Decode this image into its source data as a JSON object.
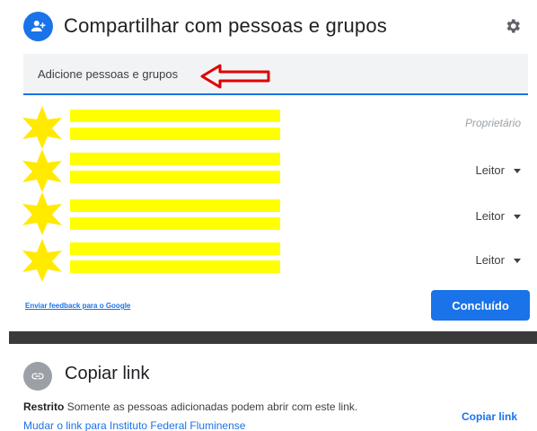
{
  "dialog": {
    "title": "Compartilhar com pessoas e grupos",
    "add_people_placeholder": "Adicione pessoas e grupos"
  },
  "people": [
    {
      "role": "Proprietário",
      "redacted": true
    },
    {
      "role": "Leitor",
      "redacted": true
    },
    {
      "role": "Leitor",
      "redacted": true
    },
    {
      "role": "Leitor",
      "redacted": true
    }
  ],
  "footer": {
    "feedback_link": "Enviar feedback para o Google",
    "done_button": "Concluído"
  },
  "link_section": {
    "title": "Copiar link",
    "restriction_label": "Restrito",
    "restriction_text": "Somente as pessoas adicionadas podem abrir com este link.",
    "change_link": "Mudar o link para Instituto Federal Fluminense",
    "copy_button": "Copiar link"
  },
  "icons": {
    "header": "add-person-icon",
    "settings": "gear-icon",
    "link": "link-icon",
    "annotation": "red-arrow-icon",
    "redaction": "yellow-star-icon"
  },
  "colors": {
    "accent": "#1a73e8",
    "redaction": "#ffff00",
    "annotation_arrow": "#e00000",
    "divider": "#3a3a3a"
  }
}
